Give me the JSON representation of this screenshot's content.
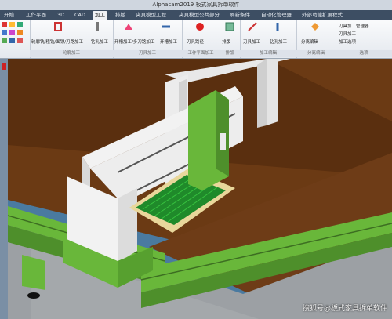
{
  "window": {
    "title": "Alphacam2019 板式家具拆单软件"
  },
  "tabs": [
    {
      "label": "开始"
    },
    {
      "label": "工作平面"
    },
    {
      "label": "3D"
    },
    {
      "label": "CAD"
    },
    {
      "label": "加工",
      "active": true
    },
    {
      "label": "排版"
    },
    {
      "label": "夹具模型工程"
    },
    {
      "label": "夹具模型公共部分"
    },
    {
      "label": "刷新条件"
    },
    {
      "label": "自动化管理器"
    },
    {
      "label": "外部功能扩展程式"
    }
  ],
  "ribbon": {
    "group1": {
      "label": "轮廓加工",
      "buttons": [
        "轮廓铣/粗铣/面铣/刀路加工",
        "钻孔加工"
      ]
    },
    "group2": {
      "label": "刀具加工",
      "buttons": [
        "开槽加工/多刀路加工",
        "开槽加工"
      ]
    },
    "group3": {
      "label": "工作平面加工",
      "buttons": [
        "刀具路径"
      ]
    },
    "group4": {
      "label": "排版",
      "buttons": [
        "排版"
      ]
    },
    "group5": {
      "label": "加工编辑",
      "buttons": [
        "刀具加工",
        "钻孔加工"
      ]
    },
    "group6": {
      "label": "分离编辑",
      "buttons": [
        "分离编辑"
      ]
    },
    "group7": {
      "label": "选项",
      "buttons": [
        "刀具加工管理器",
        "刀具加工",
        "加工选项"
      ]
    }
  },
  "colors": {
    "machine_green": "#69b73a",
    "beam_white": "#f2f2f2",
    "table_brown": "#6b3a14",
    "panel_wood": "#e9d79b",
    "vacuum_green": "#1f8a2a"
  },
  "watermark": {
    "text": "搜狐号@板式家具拆单软件"
  }
}
